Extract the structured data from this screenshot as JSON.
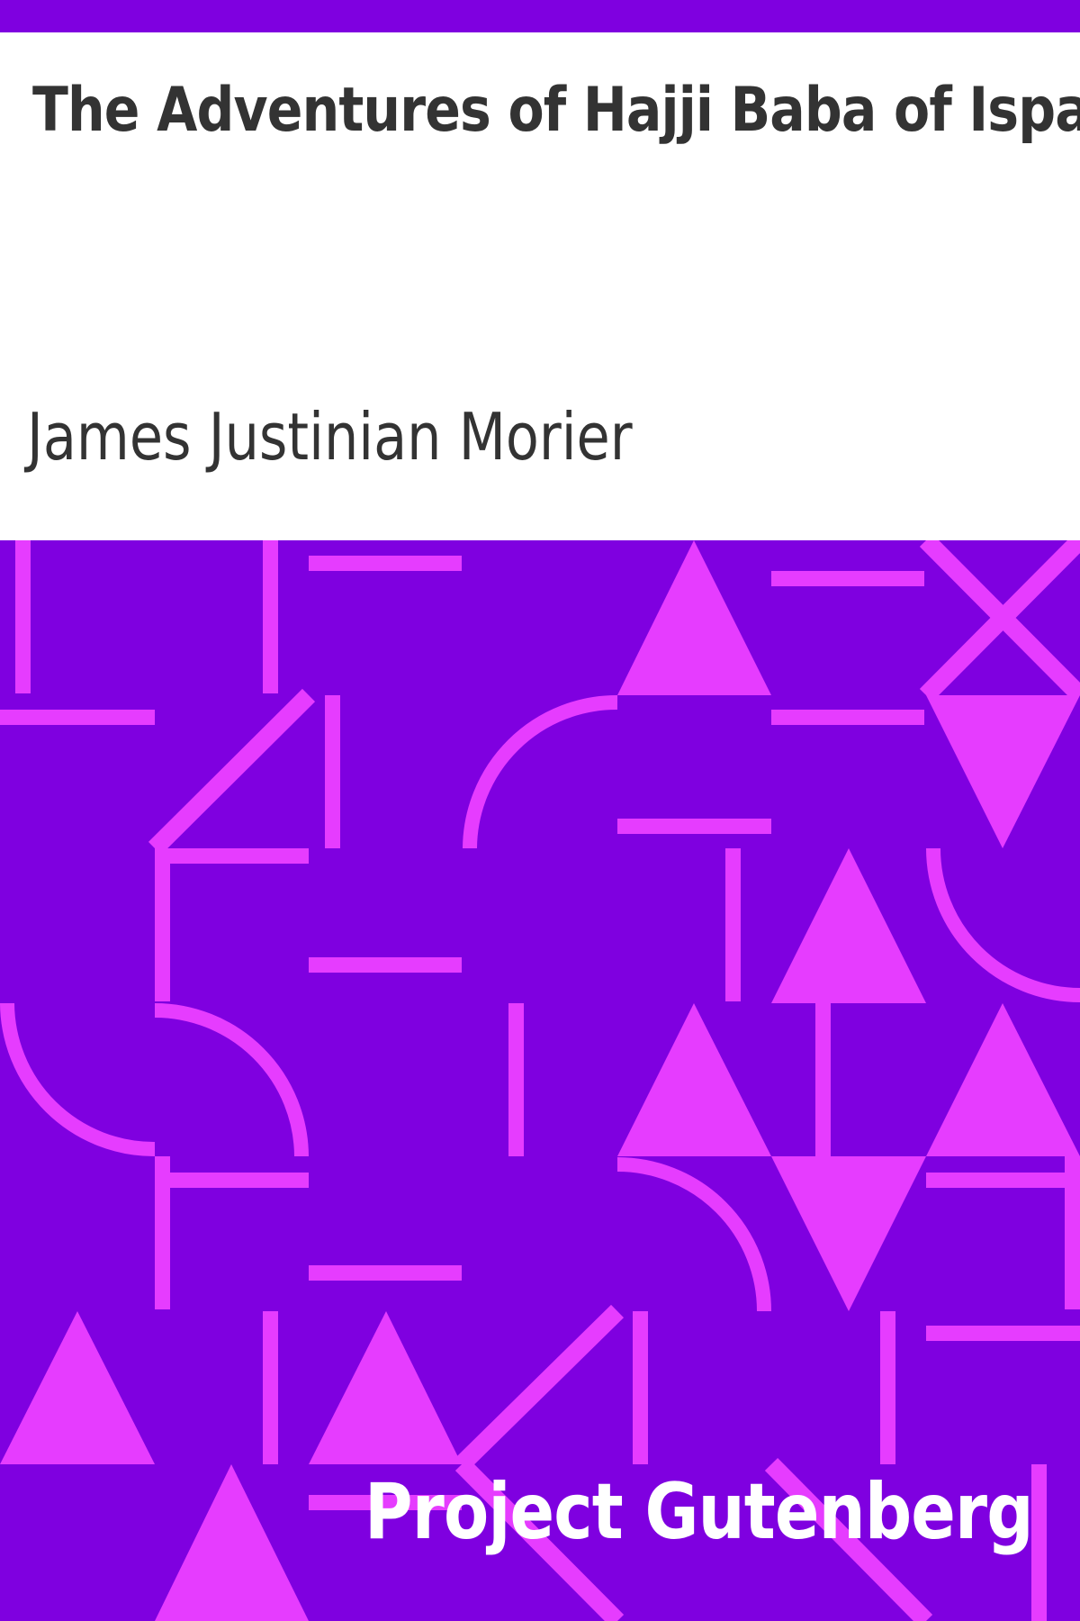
{
  "cover": {
    "title": "The Adventures of Hajji Baba of Ispahan",
    "author": "James Justinian Morier",
    "publisher": "Project Gutenberg"
  },
  "colors": {
    "background_purple": "#7f00e0",
    "pattern_magenta": "#e63cff",
    "text_dark": "#333333",
    "text_light": "#ffffff",
    "title_panel": "#ffffff"
  },
  "pattern": {
    "description_icon": "geometric-tile-pattern",
    "shapes": [
      "triangle",
      "line",
      "arc",
      "cross"
    ]
  }
}
